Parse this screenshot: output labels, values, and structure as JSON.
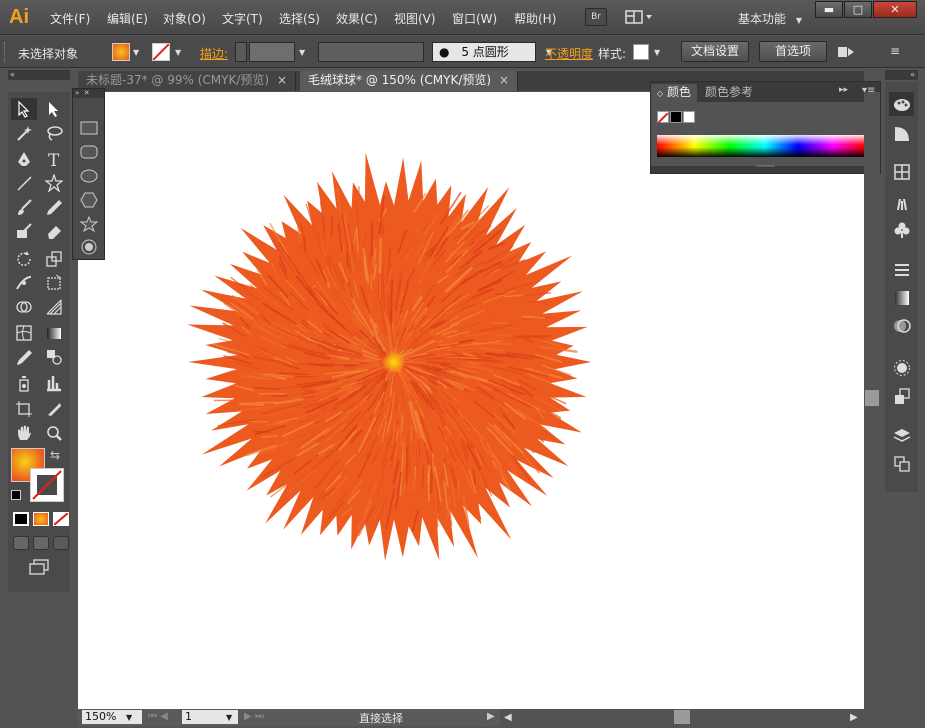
{
  "app": {
    "logo": "Ai",
    "bridge": "Br",
    "workspace": "基本功能"
  },
  "menu": [
    "文件(F)",
    "编辑(E)",
    "对象(O)",
    "文字(T)",
    "选择(S)",
    "效果(C)",
    "视图(V)",
    "窗口(W)",
    "帮助(H)"
  ],
  "window_controls": {
    "minimize": "▬",
    "maximize": "□",
    "close": "✕"
  },
  "control_bar": {
    "selection_status": "未选择对象",
    "stroke_label": "描边:",
    "brush": "5 点圆形",
    "opacity_label": "不透明度",
    "style_label": "样式:",
    "doc_setup": "文档设置",
    "preferences": "首选项"
  },
  "tabs": [
    {
      "label": "未标题-37* @ 99% (CMYK/预览)",
      "close": "×"
    },
    {
      "label": "毛绒球球* @ 150% (CMYK/预览)",
      "close": "×"
    }
  ],
  "color_panel": {
    "tab_color": "颜色",
    "tab_guide": "颜色参考"
  },
  "status": {
    "zoom": "150%",
    "page": "1",
    "tool": "直接选择"
  },
  "colors": {
    "accent": "#f7a11a",
    "fur": "#ec5a1f",
    "fur_dark": "#d83a1a",
    "fur_light": "#f48a3a"
  }
}
